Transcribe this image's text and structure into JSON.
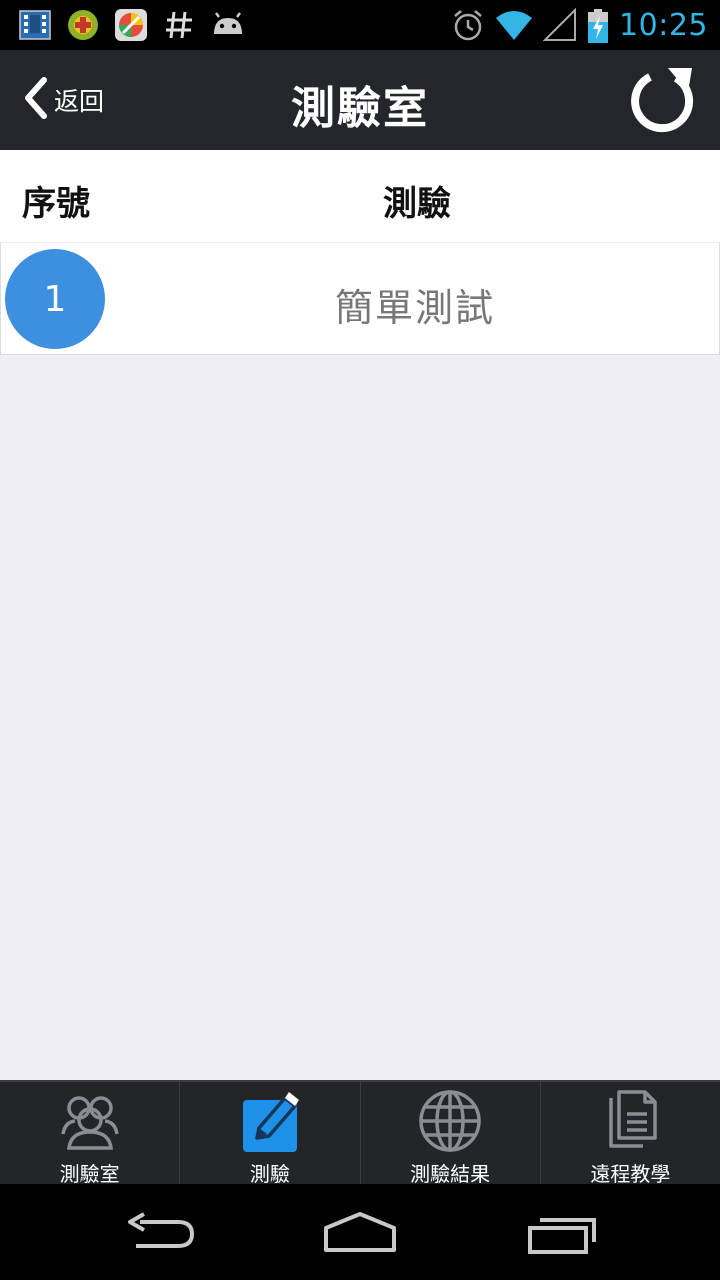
{
  "status_bar": {
    "time": "10:25",
    "icons": [
      "film-icon",
      "game-icon",
      "shield-app-icon",
      "hash-icon",
      "android-icon",
      "alarm-icon",
      "wifi-icon",
      "signal-icon",
      "battery-charging-icon"
    ]
  },
  "header": {
    "back_label": "返回",
    "title": "測驗室",
    "icons": [
      "chevron-left-icon",
      "refresh-icon"
    ]
  },
  "columns": {
    "seq": "序號",
    "test": "測驗"
  },
  "list": [
    {
      "index": "1",
      "title": "簡單測試"
    }
  ],
  "tabs": [
    {
      "label": "測驗室",
      "icon": "group-icon",
      "active": false
    },
    {
      "label": "測驗",
      "icon": "edit-icon",
      "active": true
    },
    {
      "label": "測驗結果",
      "icon": "globe-icon",
      "active": false
    },
    {
      "label": "遠程教學",
      "icon": "document-icon",
      "active": false
    }
  ],
  "nav": {
    "icons": [
      "back-icon",
      "home-icon",
      "recent-apps-icon"
    ]
  },
  "colors": {
    "header_bg": "#23272b",
    "accent_blue": "#3d8fe0",
    "active_tab_blue": "#1e90e8",
    "clock_blue": "#33b5e5",
    "page_bg": "#efeff5"
  }
}
